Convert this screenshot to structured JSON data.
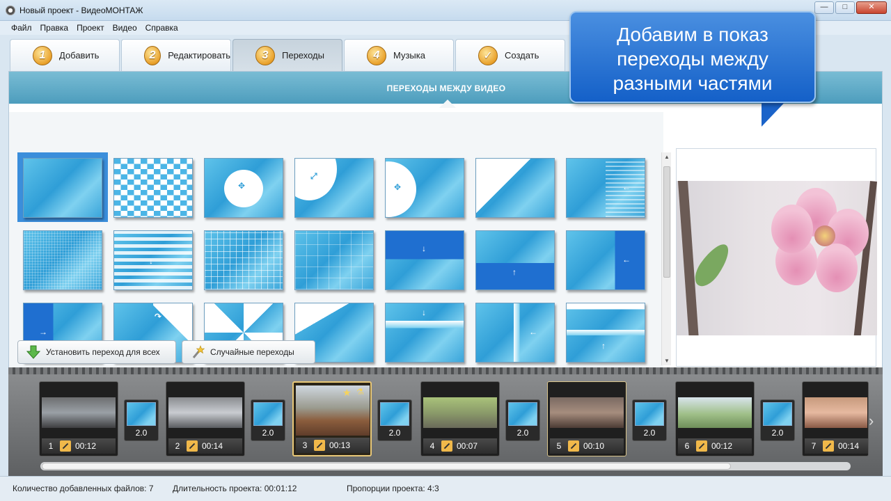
{
  "window": {
    "title": "Новый проект - ВидеоМОНТАЖ",
    "minimize": "—",
    "maximize": "□",
    "close": "✕"
  },
  "menu": [
    "Файл",
    "Правка",
    "Проект",
    "Видео",
    "Справка"
  ],
  "tabs": [
    {
      "num": "1",
      "label": "Добавить"
    },
    {
      "num": "2",
      "label": "Редактировать"
    },
    {
      "num": "3",
      "label": "Переходы",
      "active": true
    },
    {
      "num": "4",
      "label": "Музыка"
    },
    {
      "num": "✓",
      "label": "Создать"
    }
  ],
  "panel": {
    "title": "ПЕРЕХОДЫ МЕЖДУ ВИДЕО"
  },
  "buttons": {
    "apply_all": "Установить переход для всех",
    "random": "Случайные переходы"
  },
  "timeline": {
    "clips": [
      {
        "num": "1",
        "time": "00:12"
      },
      {
        "num": "2",
        "time": "00:14"
      },
      {
        "num": "3",
        "time": "00:13",
        "active": true
      },
      {
        "num": "4",
        "time": "00:07"
      },
      {
        "num": "5",
        "time": "00:10"
      },
      {
        "num": "6",
        "time": "00:12"
      },
      {
        "num": "7",
        "time": "00:14"
      }
    ],
    "transitions": [
      "2.0",
      "2.0",
      "2.0",
      "2.0",
      "2.0",
      "2.0"
    ]
  },
  "status": {
    "files": "Количество добавленных файлов: 7",
    "duration": "Длительность проекта:  00:01:12",
    "ratio": "Пропорции проекта:  4:3"
  },
  "callout": {
    "line1": "Добавим в показ",
    "line2": "переходы между",
    "line3": "разными частями"
  }
}
